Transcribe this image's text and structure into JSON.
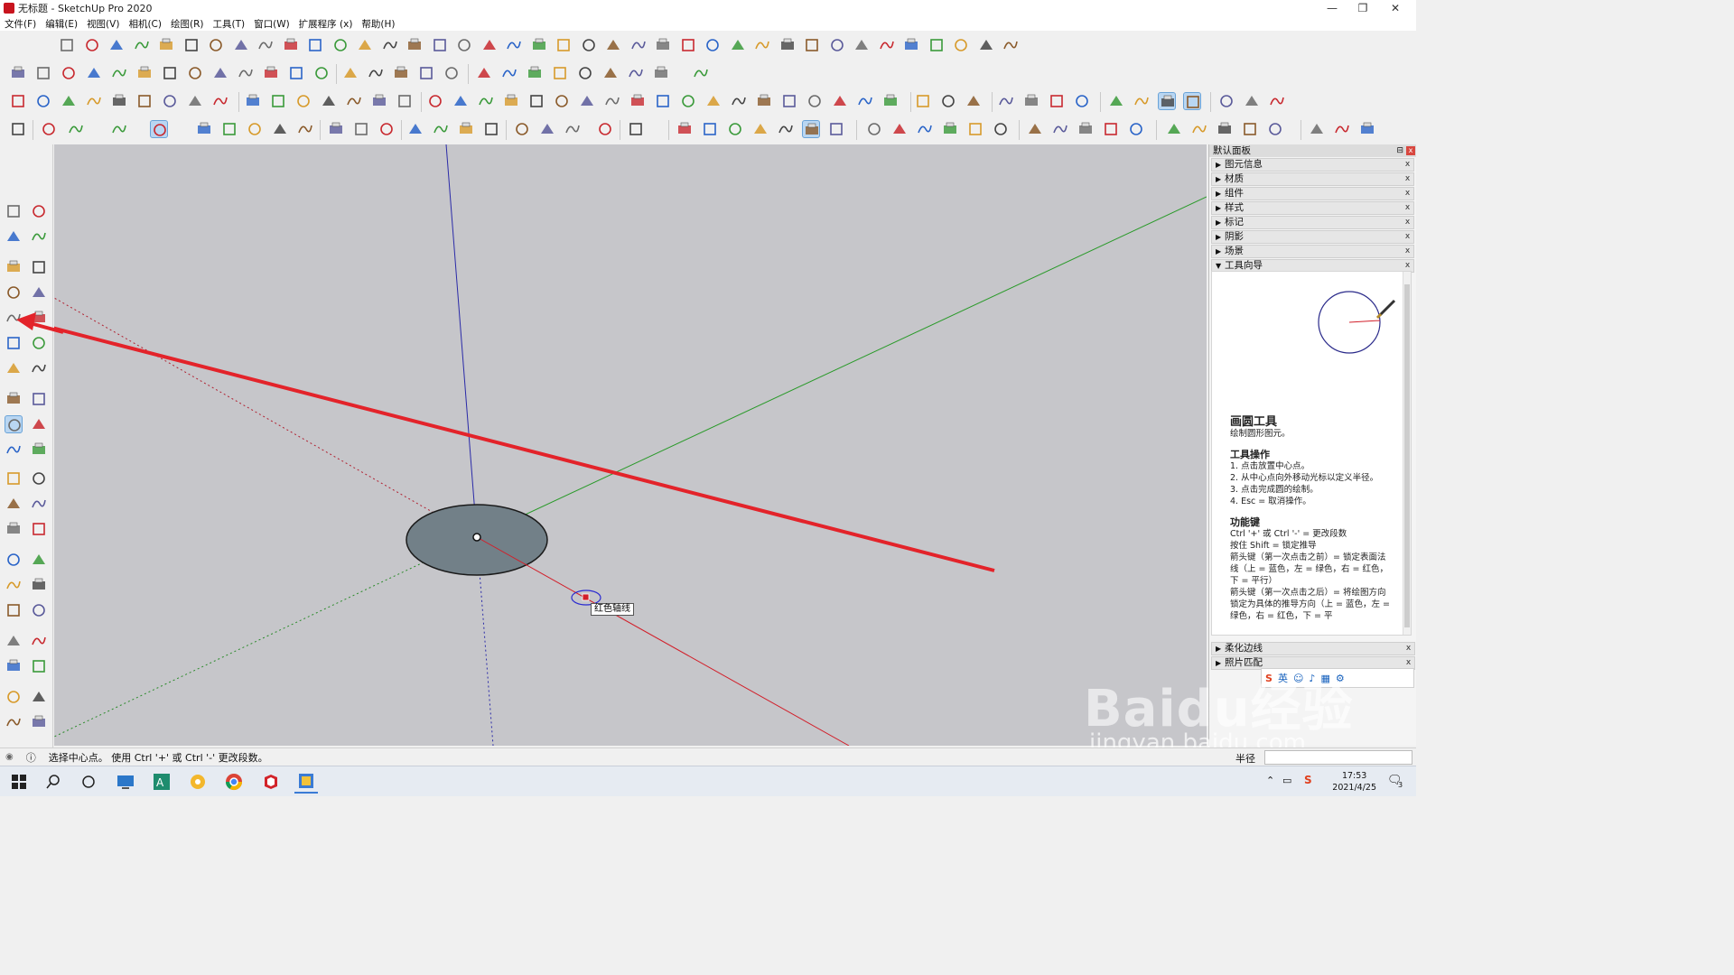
{
  "window": {
    "title": "无标题 - SketchUp Pro 2020",
    "minimize": "—",
    "restore": "❐",
    "close": "✕"
  },
  "menu": [
    "文件(F)",
    "编辑(E)",
    "视图(V)",
    "相机(C)",
    "绘图(R)",
    "工具(T)",
    "窗口(W)",
    "扩展程序 (x)",
    "帮助(H)"
  ],
  "viewport": {
    "tooltip": "红色轴线",
    "colors": {
      "bg": "#c6c6ca",
      "red_axis": "#d21f2a",
      "green_axis": "#2a9a2a",
      "blue_axis": "#2a2aa8",
      "circle_fill": "#728088",
      "annotation_arrow": "#e3232a"
    }
  },
  "panel": {
    "title": "默认面板",
    "pin": "⊟",
    "close": "x",
    "trays": [
      {
        "label": "图元信息",
        "expanded": false
      },
      {
        "label": "材质",
        "expanded": false
      },
      {
        "label": "组件",
        "expanded": false
      },
      {
        "label": "样式",
        "expanded": false
      },
      {
        "label": "标记",
        "expanded": false
      },
      {
        "label": "阴影",
        "expanded": false
      },
      {
        "label": "场景",
        "expanded": false
      },
      {
        "label": "工具向导",
        "expanded": true
      }
    ],
    "bottom_trays": [
      {
        "label": "柔化边线"
      },
      {
        "label": "照片匹配"
      }
    ],
    "tray_close": "x",
    "instructor": {
      "heading": "画圆工具",
      "subheading": "绘制圆形图元。",
      "ops_title": "工具操作",
      "ops": [
        "1. 点击放置中心点。",
        "2. 从中心点向外移动光标以定义半径。",
        "3. 点击完成圆的绘制。",
        "4. Esc = 取消操作。"
      ],
      "keys_title": "功能键",
      "keys": [
        "Ctrl '+' 或 Ctrl '-' = 更改段数",
        "按住 Shift = 锁定推导",
        "箭头键（第一次点击之前）= 锁定表面法线（上 = 蓝色，左 = 绿色，右 = 红色，下 = 平行）",
        "箭头键（第一次点击之后）= 将绘图方向锁定为具体的推导方向（上 = 蓝色，左 = 绿色，右 = 红色，下 = 平"
      ]
    }
  },
  "ime": {
    "label": "英",
    "logo": "S"
  },
  "statusbar": {
    "text": "选择中心点。 使用 Ctrl '+' 或 Ctrl '-' 更改段数。",
    "measure_label": "半径"
  },
  "taskbar": {
    "time": "17:53",
    "date": "2021/4/25",
    "notif_count": "3"
  },
  "watermark": {
    "brand": "Baidu经验",
    "url": "jingyan.baidu.com"
  }
}
